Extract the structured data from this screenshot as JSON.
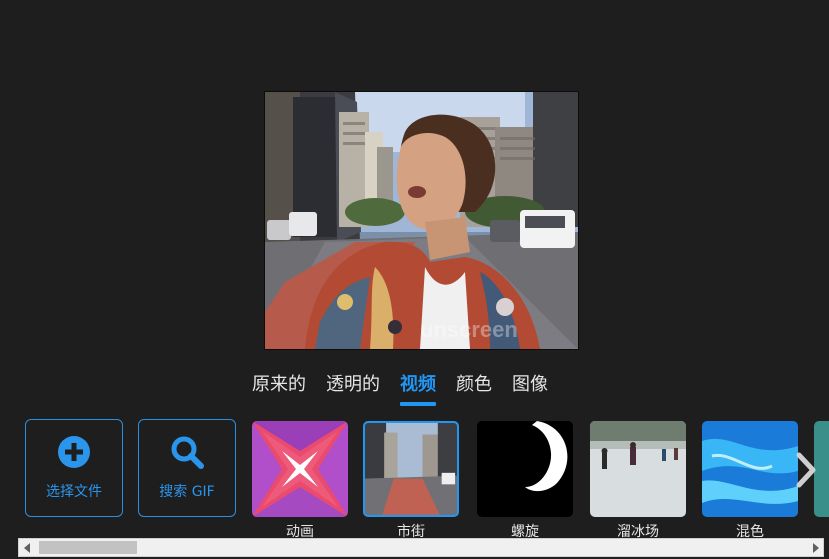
{
  "tabs": [
    {
      "label": "原来的",
      "active": false
    },
    {
      "label": "透明的",
      "active": false
    },
    {
      "label": "视频",
      "active": true
    },
    {
      "label": "颜色",
      "active": false
    },
    {
      "label": "图像",
      "active": false
    }
  ],
  "actions": {
    "select_file": {
      "label": "选择文件",
      "icon": "plus-circle-icon"
    },
    "search_gif": {
      "label": "搜索 GIF",
      "icon": "search-icon"
    }
  },
  "thumbnails": [
    {
      "label": "动画",
      "selected": false
    },
    {
      "label": "市街",
      "selected": true
    },
    {
      "label": "螺旋",
      "selected": false
    },
    {
      "label": "溜冰场",
      "selected": false
    },
    {
      "label": "混色",
      "selected": false
    }
  ],
  "watermark": "unscreen",
  "colors": {
    "accent": "#2196f3",
    "background": "#1e1e1f",
    "text": "#e6e6e6"
  }
}
